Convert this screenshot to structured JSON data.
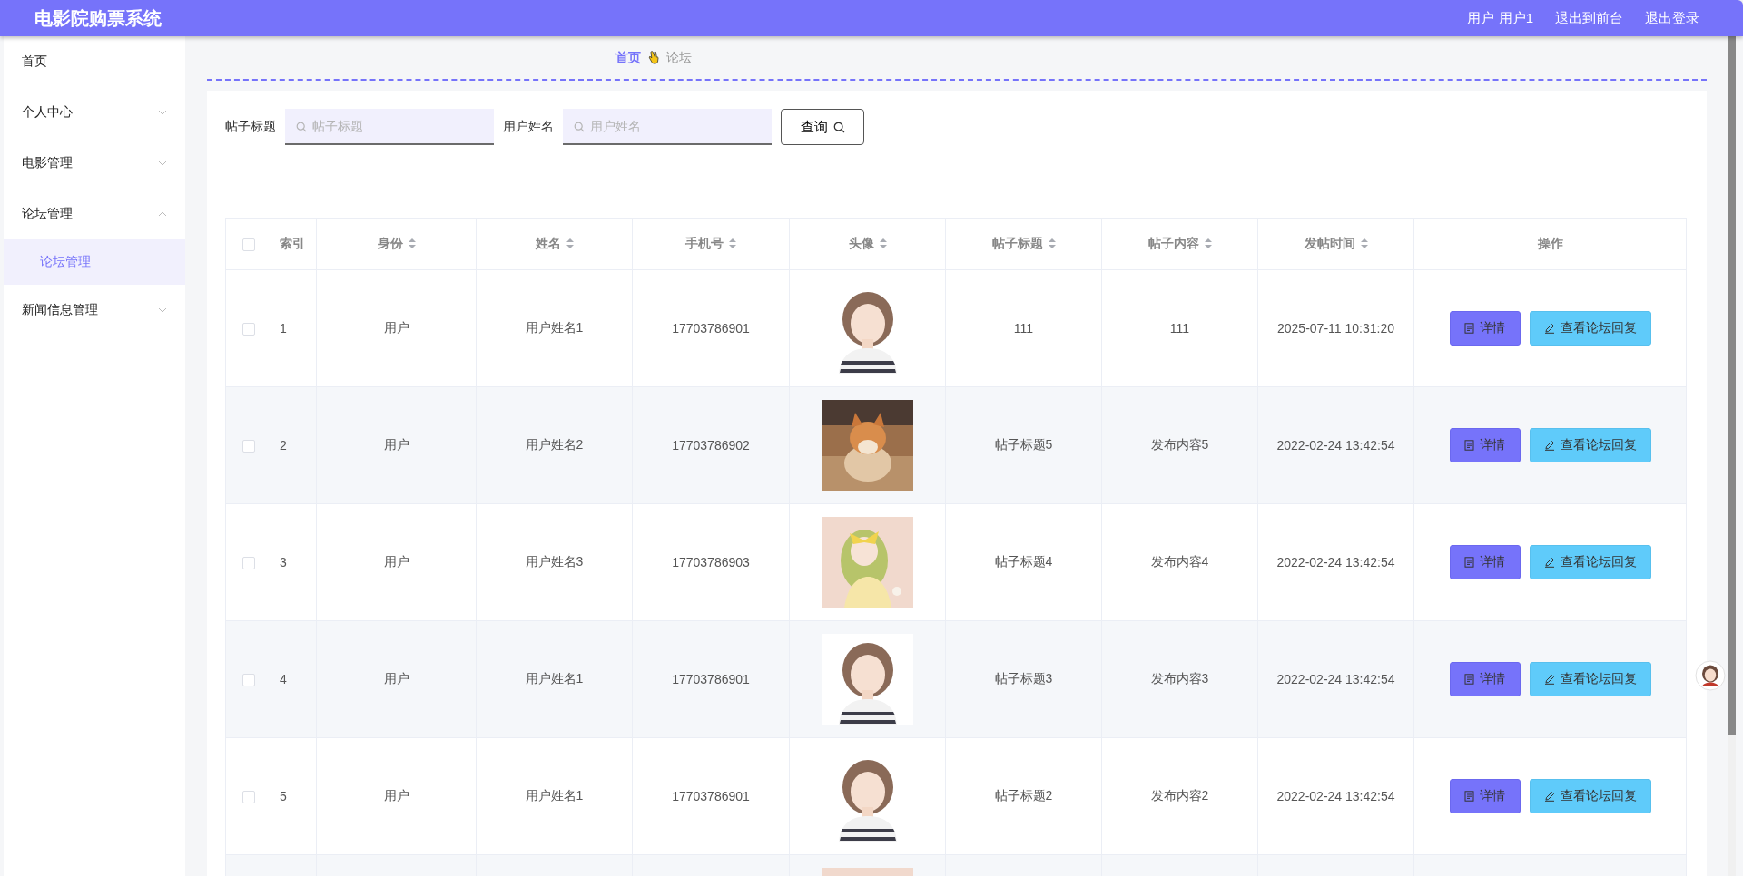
{
  "header": {
    "title": "电影院购票系统",
    "links": [
      {
        "label": "用户 用户1"
      },
      {
        "label": "退出到前台"
      },
      {
        "label": "退出登录"
      }
    ]
  },
  "sidebar": {
    "items": [
      {
        "label": "首页",
        "kind": "link",
        "selected": false
      },
      {
        "label": "个人中心",
        "kind": "group",
        "expanded": false,
        "selected": false
      },
      {
        "label": "电影管理",
        "kind": "group",
        "expanded": false,
        "selected": false
      },
      {
        "label": "论坛管理",
        "kind": "group",
        "expanded": true,
        "selected": false,
        "children": [
          {
            "label": "论坛管理",
            "selected": true
          }
        ]
      },
      {
        "label": "新闻信息管理",
        "kind": "group",
        "expanded": false,
        "selected": false
      }
    ]
  },
  "breadcrumb": [
    {
      "label": "首页",
      "current": false
    },
    {
      "label": "论坛",
      "current": true
    }
  ],
  "search": {
    "fields": [
      {
        "label": "帖子标题",
        "placeholder": "帖子标题"
      },
      {
        "label": "用户姓名",
        "placeholder": "用户姓名"
      }
    ],
    "button": "查询"
  },
  "table": {
    "select_all": {
      "checked": false
    },
    "columns": [
      {
        "label": "索引",
        "sortable": false
      },
      {
        "label": "身份",
        "sortable": true
      },
      {
        "label": "姓名",
        "sortable": true
      },
      {
        "label": "手机号",
        "sortable": true
      },
      {
        "label": "头像",
        "sortable": true
      },
      {
        "label": "帖子标题",
        "sortable": true
      },
      {
        "label": "帖子内容",
        "sortable": true
      },
      {
        "label": "发帖时间",
        "sortable": true
      },
      {
        "label": "操作",
        "sortable": false
      }
    ],
    "rows": [
      {
        "checked": false,
        "index": "1",
        "role": "用户",
        "name": "用户姓名1",
        "phone": "17703786901",
        "avatar": {
          "kind": "picture"
        },
        "title": "111",
        "content": "111",
        "time": "2025-07-11 10:31:20",
        "actions": [
          "详情",
          "查看论坛回复"
        ]
      },
      {
        "checked": false,
        "index": "2",
        "role": "用户",
        "name": "用户姓名2",
        "phone": "17703786902",
        "avatar": {
          "kind": "picture"
        },
        "title": "帖子标题5",
        "content": "发布内容5",
        "time": "2022-02-24 13:42:54",
        "actions": [
          "详情",
          "查看论坛回复"
        ]
      },
      {
        "checked": false,
        "index": "3",
        "role": "用户",
        "name": "用户姓名3",
        "phone": "17703786903",
        "avatar": {
          "kind": "picture"
        },
        "title": "帖子标题4",
        "content": "发布内容4",
        "time": "2022-02-24 13:42:54",
        "actions": [
          "详情",
          "查看论坛回复"
        ]
      },
      {
        "checked": false,
        "index": "4",
        "role": "用户",
        "name": "用户姓名1",
        "phone": "17703786901",
        "avatar": {
          "kind": "picture"
        },
        "title": "帖子标题3",
        "content": "发布内容3",
        "time": "2022-02-24 13:42:54",
        "actions": [
          "详情",
          "查看论坛回复"
        ]
      },
      {
        "checked": false,
        "index": "5",
        "role": "用户",
        "name": "用户姓名1",
        "phone": "17703786901",
        "avatar": {
          "kind": "picture"
        },
        "title": "帖子标题2",
        "content": "发布内容2",
        "time": "2022-02-24 13:42:54",
        "actions": [
          "详情",
          "查看论坛回复"
        ]
      },
      {
        "avatar": {
          "kind": "picture"
        }
      }
    ]
  }
}
